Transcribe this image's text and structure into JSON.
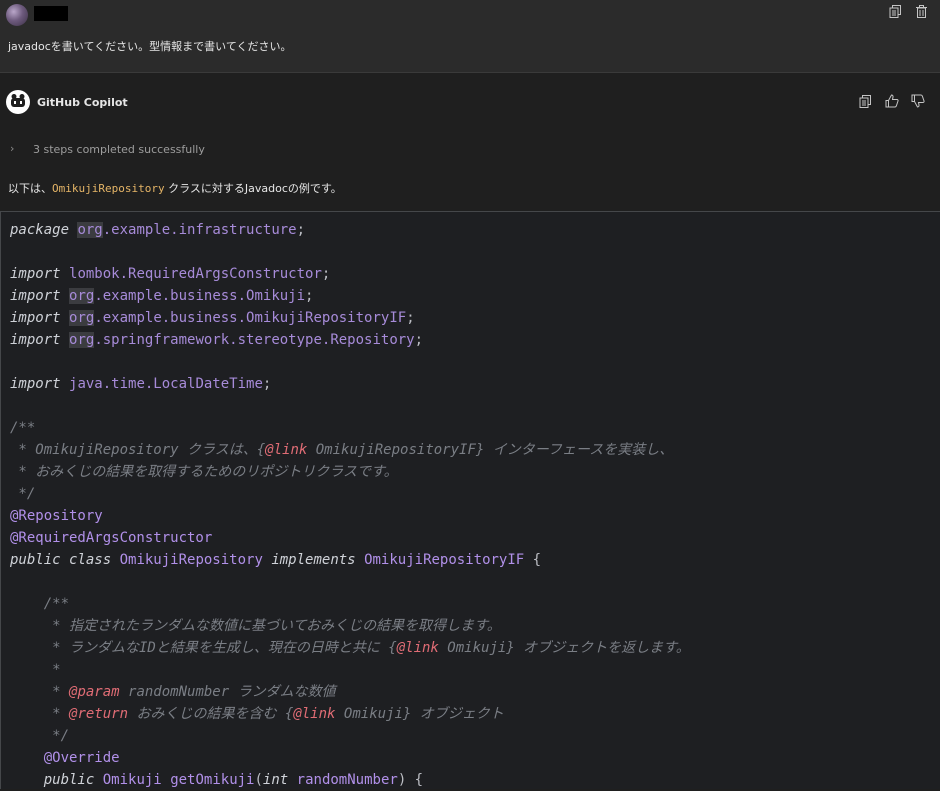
{
  "user": {
    "message": "javadocを書いてください。型情報まで書いてください。"
  },
  "assistant": {
    "name": "GitHub Copilot",
    "steps_text": "3 steps completed successfully",
    "intro_prefix": "以下は、",
    "intro_code": "OmikujiRepository",
    "intro_suffix": " クラスに対するJavadocの例です。"
  },
  "icons": {
    "user_actions": [
      "copy-icon",
      "trash-icon"
    ],
    "assistant_actions": [
      "copy-icon",
      "thumbs-up-icon",
      "thumbs-down-icon"
    ],
    "chevron": "chevron-right-icon"
  },
  "colors": {
    "keyword": "#cfd2d8",
    "package": "#a78bd9",
    "class": "#b190e9",
    "doc_comment": "#7a7e85",
    "doc_tag": "#e06c75",
    "inline_code": "#e5b567"
  },
  "code": {
    "l1": [
      "package",
      " ",
      "org",
      ".example.infrastructure",
      ";"
    ],
    "l3": [
      "import",
      " ",
      "lombok.RequiredArgsConstructor",
      ";"
    ],
    "l4": [
      "import",
      " ",
      "org",
      ".example.business.Omikuji",
      ";"
    ],
    "l5": [
      "import",
      " ",
      "org",
      ".example.business.OmikujiRepositoryIF",
      ";"
    ],
    "l6": [
      "import",
      " ",
      "org",
      ".springframework.stereotype.Repository",
      ";"
    ],
    "l8": [
      "import",
      " ",
      "java.time.LocalDateTime",
      ";"
    ],
    "l10": "/**",
    "l11": [
      " * OmikujiRepository クラスは、{",
      "@link",
      " OmikujiRepositoryIF} インターフェースを実装し、"
    ],
    "l12": " * おみくじの結果を取得するためのリポジトリクラスです。",
    "l13": " */",
    "l14": "@Repository",
    "l15": "@RequiredArgsConstructor",
    "l16": [
      "public class",
      " ",
      "OmikujiRepository",
      " ",
      "implements",
      " ",
      "OmikujiRepositoryIF",
      " {"
    ],
    "l18": "    /**",
    "l19": "     * 指定されたランダムな数値に基づいておみくじの結果を取得します。",
    "l20": [
      "     * ランダムなIDと結果を生成し、現在の日時と共に {",
      "@link",
      " Omikuji} オブジェクトを返します。"
    ],
    "l21": "     *",
    "l22": [
      "     * ",
      "@param",
      " randomNumber ランダムな数値"
    ],
    "l23": [
      "     * ",
      "@return",
      " おみくじの結果を含む {",
      "@link",
      " Omikuji} オブジェクト"
    ],
    "l24": "     */",
    "l25": "    @Override",
    "l26": [
      "    public",
      " ",
      "Omikuji",
      " ",
      "getOmikuji",
      "(",
      "int",
      " ",
      "randomNumber",
      ") {"
    ]
  }
}
